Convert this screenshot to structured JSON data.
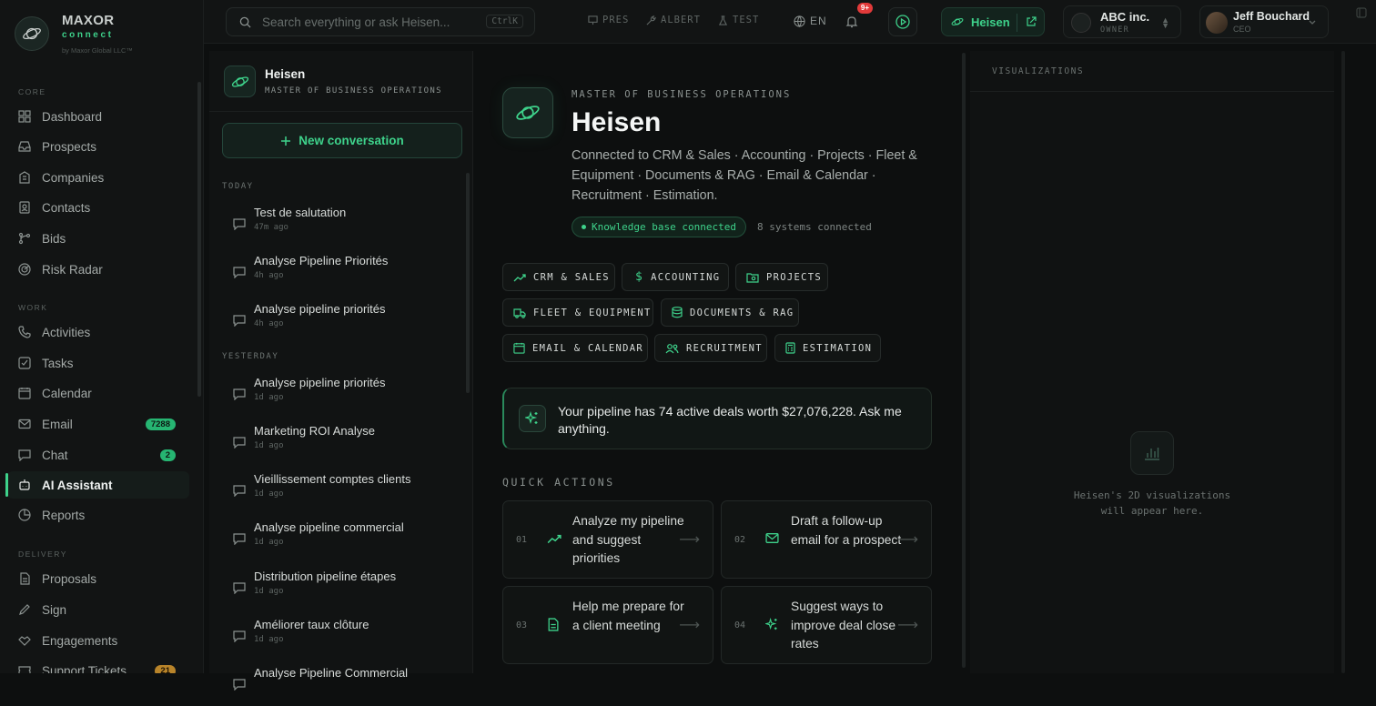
{
  "brand": {
    "name": "MAXOR",
    "sub": "connect",
    "legal": "by Maxor Global LLC™"
  },
  "sidebar": {
    "sections": [
      "CORE",
      "WORK",
      "DELIVERY"
    ],
    "items": [
      {
        "label": "Dashboard",
        "icon": "grid-icon"
      },
      {
        "label": "Prospects",
        "icon": "inbox-icon"
      },
      {
        "label": "Companies",
        "icon": "building-icon"
      },
      {
        "label": "Contacts",
        "icon": "contact-icon"
      },
      {
        "label": "Bids",
        "icon": "branch-icon"
      },
      {
        "label": "Risk Radar",
        "icon": "radar-icon"
      },
      {
        "label": "Activities",
        "icon": "phone-icon"
      },
      {
        "label": "Tasks",
        "icon": "checkbox-icon"
      },
      {
        "label": "Calendar",
        "icon": "calendar-icon"
      },
      {
        "label": "Email",
        "icon": "mail-icon",
        "badge": "7288"
      },
      {
        "label": "Chat",
        "icon": "chat-icon",
        "badge": "2"
      },
      {
        "label": "AI Assistant",
        "icon": "bot-icon"
      },
      {
        "label": "Reports",
        "icon": "pie-icon"
      },
      {
        "label": "Proposals",
        "icon": "file-icon"
      },
      {
        "label": "Sign",
        "icon": "pen-icon"
      },
      {
        "label": "Engagements",
        "icon": "handshake-icon"
      },
      {
        "label": "Support Tickets",
        "icon": "ticket-icon",
        "badge": "21"
      }
    ]
  },
  "topbar": {
    "search_placeholder": "Search everything or ask Heisen...",
    "shortcut": "CtrlK",
    "nav": [
      "PRES",
      "ALBERT",
      "TEST"
    ],
    "lang": "EN",
    "notif_count": "9+",
    "assistant": "Heisen",
    "company": {
      "name": "ABC inc.",
      "role": "OWNER"
    },
    "user": {
      "name": "Jeff Bouchard",
      "role": "CEO"
    }
  },
  "conversations": {
    "assistant_name": "Heisen",
    "assistant_title": "MASTER OF BUSINESS OPERATIONS",
    "new_label": "New conversation",
    "groups": [
      "TODAY",
      "YESTERDAY"
    ],
    "items": [
      {
        "title": "Test de salutation",
        "time": "47m ago"
      },
      {
        "title": "Analyse Pipeline Priorités",
        "time": "4h ago"
      },
      {
        "title": "Analyse pipeline priorités",
        "time": "4h ago"
      },
      {
        "title": "Analyse pipeline priorités",
        "time": "1d ago"
      },
      {
        "title": "Marketing ROI Analyse",
        "time": "1d ago"
      },
      {
        "title": "Vieillissement comptes clients",
        "time": "1d ago"
      },
      {
        "title": "Analyse pipeline commercial",
        "time": "1d ago"
      },
      {
        "title": "Distribution pipeline étapes",
        "time": "1d ago"
      },
      {
        "title": "Améliorer taux clôture",
        "time": "1d ago"
      },
      {
        "title": "Analyse Pipeline Commercial",
        "time": ""
      }
    ]
  },
  "main": {
    "kicker": "MASTER OF BUSINESS OPERATIONS",
    "title": "Heisen",
    "description": "Connected to CRM & Sales · Accounting · Projects · Fleet & Equipment · Documents & RAG · Email & Calendar · Recruitment · Estimation.",
    "kb_status": "Knowledge base connected",
    "systems": "8 systems connected",
    "chips": [
      "CRM & SALES",
      "ACCOUNTING",
      "PROJECTS",
      "FLEET & EQUIPMENT",
      "DOCUMENTS & RAG",
      "EMAIL & CALENDAR",
      "RECRUITMENT",
      "ESTIMATION"
    ],
    "banner": "Your pipeline has 74 active deals worth $27,076,228. Ask me anything.",
    "quick_title": "QUICK ACTIONS",
    "quick_actions": [
      {
        "num": "01",
        "text": "Analyze my pipeline and suggest priorities"
      },
      {
        "num": "02",
        "text": "Draft a follow-up email for a prospect"
      },
      {
        "num": "03",
        "text": "Help me prepare for a client meeting"
      },
      {
        "num": "04",
        "text": "Suggest ways to improve deal close rates"
      }
    ]
  },
  "viz": {
    "title": "VISUALIZATIONS",
    "empty_text": "Heisen's 2D visualizations will appear here."
  },
  "colors": {
    "accent": "#3ed28b",
    "background": "#0d0f0f",
    "alert": "#e23a3a"
  }
}
